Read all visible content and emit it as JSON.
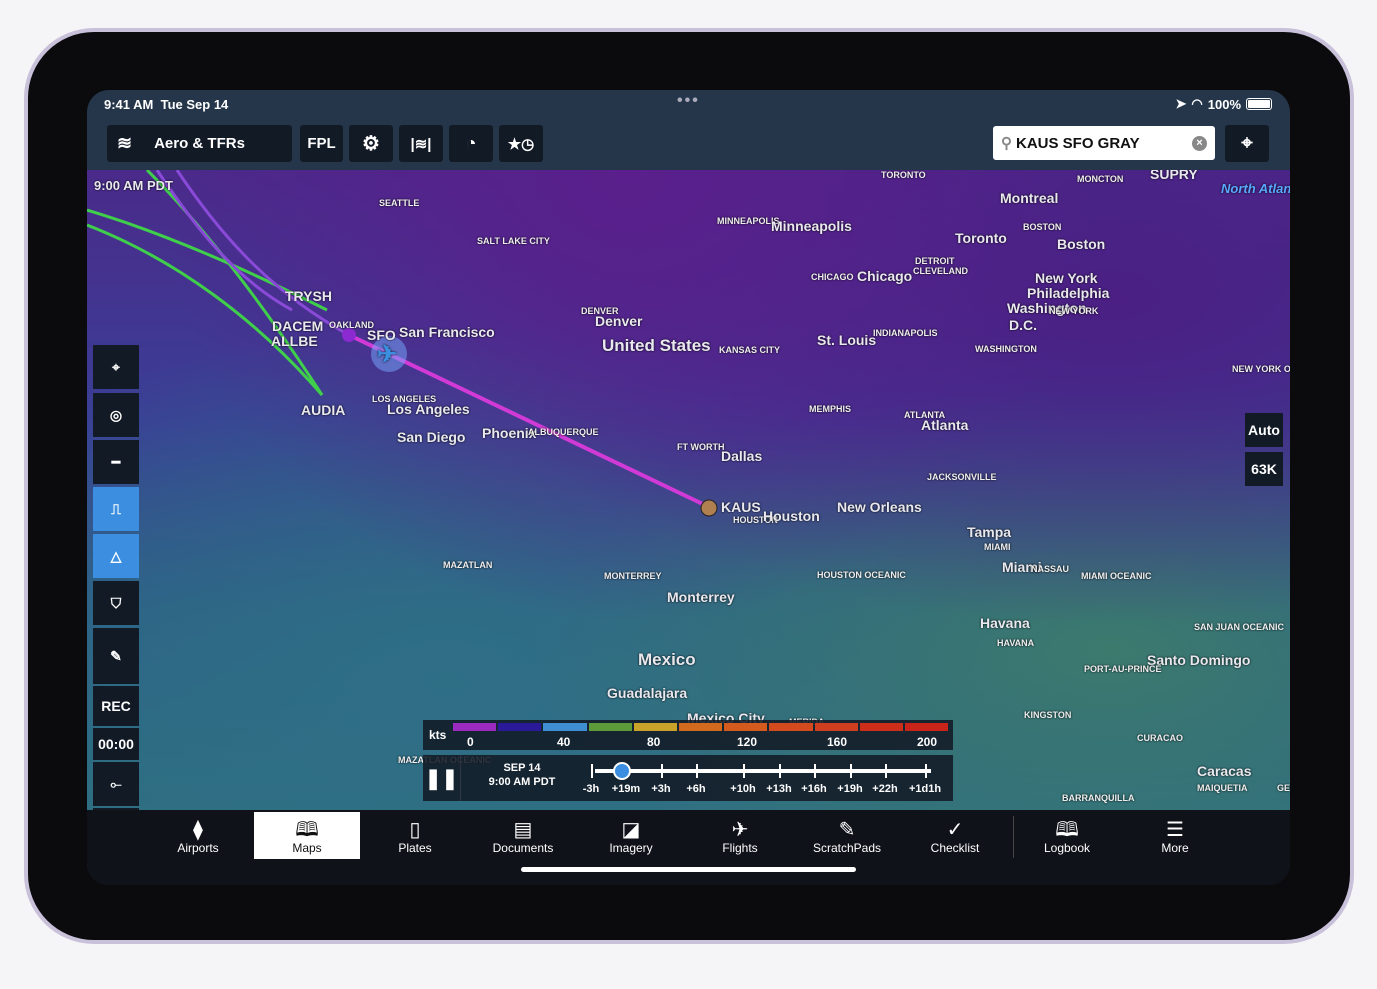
{
  "status": {
    "time": "9:41 AM",
    "date": "Tue Sep 14",
    "battery": "100%"
  },
  "toolbar": {
    "layers_label": "Aero & TFRs",
    "fpl": "FPL",
    "search_value": "KAUS SFO GRAY"
  },
  "map": {
    "time_label": "9:00 AM PDT",
    "labels": [
      "SEATTLE",
      "SALT LAKE CITY",
      "MINNEAPOLIS",
      "Minneapolis",
      "TORONTO",
      "Toronto",
      "MONCTON",
      "SUPRY",
      "Montreal",
      "BOSTON",
      "Boston",
      "New York",
      "Philadelphia",
      "Washington",
      "D.C.",
      "NEW YORK",
      "DETROIT",
      "CLEVELAND",
      "CHICAGO",
      "Chicago",
      "DENVER",
      "Denver",
      "United States",
      "KANSAS CITY",
      "St. Louis",
      "INDIANAPOLIS",
      "WASHINGTON",
      "MEMPHIS",
      "ATLANTA",
      "Atlanta",
      "FT WORTH",
      "Dallas",
      "JACKSONVILLE",
      "KAUS",
      "HOUSTON",
      "Houston",
      "New Orleans",
      "Tampa",
      "MIAMI",
      "Miami",
      "NASSAU",
      "LOS ANGELES",
      "Los Angeles",
      "San Diego",
      "Phoenix",
      "ALBUQUERQUE",
      "OAKLAND",
      "SFO",
      "San Francisco",
      "TRYSH",
      "DACEM",
      "ALLBE",
      "AUDIA",
      "MAZATLAN",
      "MONTERREY",
      "Monterrey",
      "HOUSTON OCEANIC",
      "MIAMI OCEANIC",
      "Mexico",
      "Guadalajara",
      "Mexico City",
      "MERIDA",
      "Havana",
      "HAVANA",
      "KINGSTON",
      "SAN JUAN OCEANIC",
      "Santo Domingo",
      "PORT-AU-PRINCE",
      "CURACAO",
      "Caracas",
      "BARRANQUILLA",
      "MAIQUETIA",
      "GEORGETOWN",
      "NEW YORK OCEANIC",
      "North Atlantic Ocean",
      "MAZATLAN OCEANIC"
    ],
    "side_rec": "REC",
    "side_timer": "00:00",
    "auto": "Auto",
    "altitude": "63K"
  },
  "legend": {
    "unit": "kts",
    "ticks": [
      "0",
      "40",
      "80",
      "120",
      "160",
      "200"
    ],
    "colors": [
      "#9b2bbf",
      "#2a1a9a",
      "#3f8fd0",
      "#5c9a3a",
      "#c9a22a",
      "#d26a1e",
      "#d55a1e",
      "#d24a1e",
      "#cf3e1e",
      "#cc2e1a",
      "#c8241a"
    ]
  },
  "timeline": {
    "date": "SEP 14",
    "time": "9:00 AM PDT",
    "ticks": [
      "-3h",
      "+19m",
      "+3h",
      "+6h",
      "+10h",
      "+13h",
      "+16h",
      "+19h",
      "+22h",
      "+1d1h"
    ],
    "progress": 0.03
  },
  "tabs": [
    {
      "label": "Airports",
      "icon": "airport-icon",
      "glyph": "⧫"
    },
    {
      "label": "Maps",
      "icon": "map-icon",
      "glyph": "🕮"
    },
    {
      "label": "Plates",
      "icon": "plates-icon",
      "glyph": "▯"
    },
    {
      "label": "Documents",
      "icon": "documents-icon",
      "glyph": "▤"
    },
    {
      "label": "Imagery",
      "icon": "imagery-icon",
      "glyph": "◪"
    },
    {
      "label": "Flights",
      "icon": "flights-icon",
      "glyph": "✈"
    },
    {
      "label": "ScratchPads",
      "icon": "pencil-icon",
      "glyph": "✎"
    },
    {
      "label": "Checklist",
      "icon": "checkmark-icon",
      "glyph": "✓"
    },
    {
      "label": "Logbook",
      "icon": "book-icon",
      "glyph": "🕮"
    },
    {
      "label": "More",
      "icon": "menu-icon",
      "glyph": "☰"
    }
  ],
  "active_tab": "Maps",
  "colors": {
    "route": "#d13ad6",
    "airway": "#3fcf4a",
    "active_button": "#3c8fe0"
  }
}
